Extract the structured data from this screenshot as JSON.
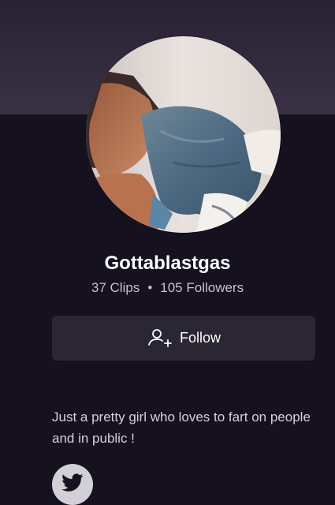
{
  "profile": {
    "username": "Gottablastgas",
    "clips_count": "37 Clips",
    "separator": "•",
    "followers_count": "105 Followers",
    "follow_label": "Follow",
    "bio": "Just a pretty girl who loves to fart on people and in public !"
  },
  "icons": {
    "follow": "add-user-icon",
    "social": "twitter-icon"
  },
  "colors": {
    "background": "#16111f",
    "banner": "#3a3146",
    "button": "#2b2633",
    "text_primary": "#ffffff",
    "text_secondary": "#c5c1cc"
  }
}
